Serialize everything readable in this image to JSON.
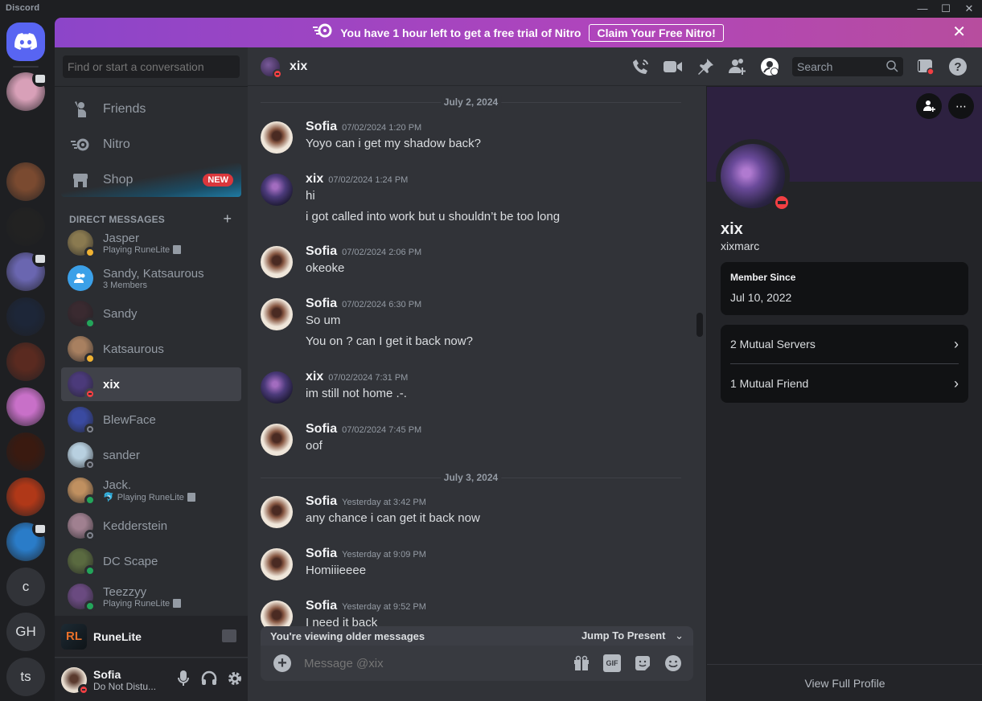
{
  "window": {
    "app_name": "Discord",
    "controls": {
      "minimize": "—",
      "maximize": "☐",
      "close": "✕"
    }
  },
  "guilds": {
    "home_icon": "discord-logo-icon",
    "servers": [
      {
        "name": "server-rat",
        "badge": "screen-share-icon",
        "color": "#d8a0b8"
      },
      {
        "name": "server-spartan",
        "badge": null,
        "color": "#1e1f22"
      },
      {
        "name": "server-gnome",
        "badge": null,
        "color": "#7a4a30"
      },
      {
        "name": "server-rainbow",
        "badge": null,
        "color": "#222"
      },
      {
        "name": "server-owl",
        "badge": "calendar-icon",
        "color": "#6a66b0"
      },
      {
        "name": "server-dark-castle",
        "badge": null,
        "color": "#1d2638"
      },
      {
        "name": "server-red-forest",
        "badge": null,
        "color": "#5a2a20"
      },
      {
        "name": "server-anime-girl",
        "badge": null,
        "color": "#c870c8"
      },
      {
        "name": "server-fracture",
        "badge": null,
        "color": "#3a1a10"
      },
      {
        "name": "server-cheese",
        "badge": null,
        "color": "#b03818"
      },
      {
        "name": "server-star",
        "badge": "screen-share-icon",
        "color": "#2a7cc8"
      }
    ],
    "text_servers": [
      "c",
      "GH",
      "ts"
    ]
  },
  "banner": {
    "icon": "nitro-icon",
    "text": "You have 1 hour left to get a free trial of Nitro",
    "button": "Claim Your Free Nitro!",
    "close": "✕"
  },
  "dm_sidebar": {
    "search_placeholder": "Find or start a conversation",
    "nav": [
      {
        "label": "Friends",
        "icon": "friends-icon"
      },
      {
        "label": "Nitro",
        "icon": "nitro-icon"
      },
      {
        "label": "Shop",
        "icon": "shop-icon",
        "badge": "NEW"
      }
    ],
    "header": "DIRECT MESSAGES",
    "add": "+",
    "dms": [
      {
        "name": "Jasper",
        "sub": "Playing RuneLite",
        "status": "idle",
        "color": "#8a7a50"
      },
      {
        "name": "Sandy, Katsaurous",
        "sub": "3 Members",
        "status": null,
        "color": "#3ba0e8",
        "group": true
      },
      {
        "name": "Sandy",
        "sub": "",
        "status": "online",
        "color": "#3a2a30"
      },
      {
        "name": "Katsaurous",
        "sub": "",
        "status": "idle",
        "color": "#a88060"
      },
      {
        "name": "xix",
        "sub": "",
        "status": "dnd",
        "color": "#4b3a7a",
        "active": true
      },
      {
        "name": "BlewFace",
        "sub": "",
        "status": "offline",
        "color": "#3a4aa0"
      },
      {
        "name": "sander",
        "sub": "",
        "status": "offline",
        "color": "#b8d0e0"
      },
      {
        "name": "Jack.",
        "sub": "Playing RuneLite",
        "status": "online",
        "color": "#c09060",
        "emoji": "🐬"
      },
      {
        "name": "Kedderstein",
        "sub": "",
        "status": "offline",
        "color": "#a08090"
      },
      {
        "name": "DC Scape",
        "sub": "",
        "status": "online",
        "color": "#5a6a40"
      },
      {
        "name": "Teezzyy",
        "sub": "Playing RuneLite",
        "status": "online",
        "color": "#6a4a80"
      }
    ],
    "activity": {
      "logo": "RL",
      "name": "RuneLite"
    },
    "user": {
      "name": "Sofia",
      "status": "Do Not Distu..."
    }
  },
  "chat": {
    "recipient": "xix",
    "search_placeholder": "Search",
    "header_icons": [
      "voice-call-icon",
      "video-call-icon",
      "pinned-icon",
      "add-friend-dm-icon",
      "user-profile-toggle-icon",
      "inbox-icon",
      "help-icon"
    ],
    "dividers": [
      "July 2, 2024",
      "July 3, 2024"
    ],
    "messages": [
      {
        "author": "Sofia",
        "time": "07/02/2024 1:20 PM",
        "lines": [
          "Yoyo can i get my shadow back?"
        ]
      },
      {
        "author": "xix",
        "time": "07/02/2024 1:24 PM",
        "lines": [
          "hi",
          "i got called into work but u shouldn’t be too long"
        ]
      },
      {
        "author": "Sofia",
        "time": "07/02/2024 2:06 PM",
        "lines": [
          "okeoke"
        ]
      },
      {
        "author": "Sofia",
        "time": "07/02/2024 6:30 PM",
        "lines": [
          "So um",
          "You on ? can I get it back now?"
        ]
      },
      {
        "author": "xix",
        "time": "07/02/2024 7:31 PM",
        "lines": [
          "im still not home .-."
        ]
      },
      {
        "author": "Sofia",
        "time": "07/02/2024 7:45 PM",
        "lines": [
          "oof"
        ]
      },
      {
        "author": "Sofia",
        "time": "Yesterday at 3:42 PM",
        "lines": [
          "any chance i can get it back now"
        ]
      },
      {
        "author": "Sofia",
        "time": "Yesterday at 9:09 PM",
        "lines": [
          "Homiiieeee"
        ]
      },
      {
        "author": "Sofia",
        "time": "Yesterday at 9:52 PM",
        "lines": [
          "I need it back"
        ]
      }
    ],
    "older_notice": "You're viewing older messages",
    "jump_label": "Jump To Present",
    "composer_placeholder": "Message @xix",
    "composer_gif": "GIF"
  },
  "profile": {
    "display_name": "xix",
    "username": "xixmarc",
    "status": "dnd",
    "member_since_label": "Member Since",
    "member_since": "Jul 10, 2022",
    "mutual_servers": "2 Mutual Servers",
    "mutual_friends": "1 Mutual Friend",
    "view_full": "View Full Profile",
    "banner_color": "#2d2140"
  }
}
